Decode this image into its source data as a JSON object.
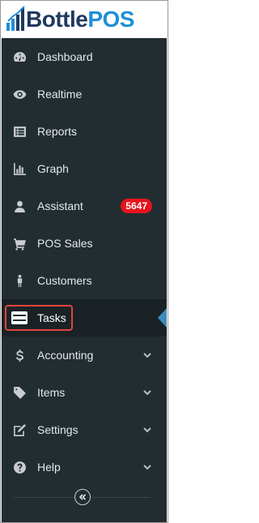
{
  "brand": {
    "part1": "Bottle",
    "part2": "POS"
  },
  "menu": [
    {
      "label": "Dashboard",
      "icon": "dashboard-icon"
    },
    {
      "label": "Realtime",
      "icon": "eye-icon"
    },
    {
      "label": "Reports",
      "icon": "reports-icon"
    },
    {
      "label": "Graph",
      "icon": "bar-chart-icon"
    },
    {
      "label": "Assistant",
      "icon": "user-icon",
      "badge": "5647"
    },
    {
      "label": "POS Sales",
      "icon": "cart-icon"
    },
    {
      "label": "Customers",
      "icon": "person-icon"
    },
    {
      "label": "Tasks",
      "icon": "tasks-icon",
      "active": true
    },
    {
      "label": "Accounting",
      "icon": "dollar-icon",
      "expandable": true
    },
    {
      "label": "Items",
      "icon": "tag-icon",
      "expandable": true
    },
    {
      "label": "Settings",
      "icon": "edit-icon",
      "expandable": true
    },
    {
      "label": "Help",
      "icon": "help-icon",
      "expandable": true
    }
  ],
  "collapse_button": {
    "icon": "double-chevron-left-icon"
  },
  "colors": {
    "sidebar_bg": "#222d32",
    "active_bg": "#1a2226",
    "badge_bg": "#e5141c",
    "active_marker": "#3c8dbc",
    "highlight_outline": "#e0453f",
    "brand_dark": "#1f3a5f",
    "brand_blue": "#1f8fd6"
  }
}
